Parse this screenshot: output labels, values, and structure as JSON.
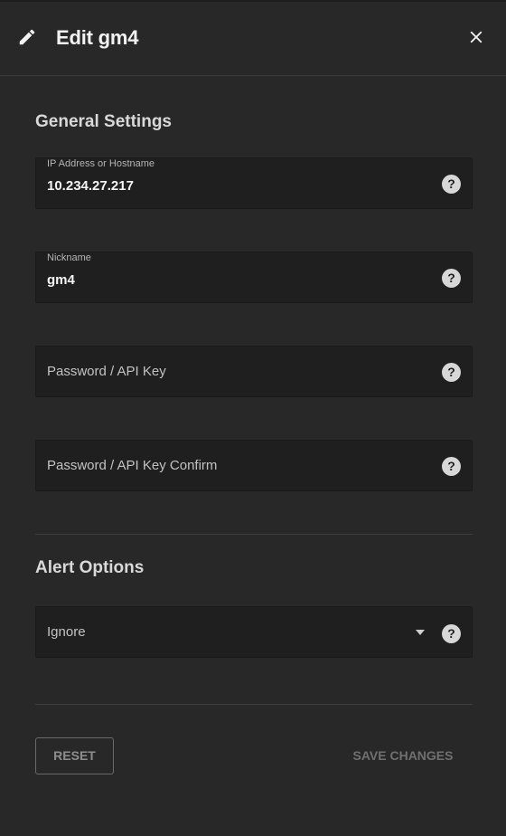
{
  "header": {
    "title": "Edit gm4",
    "edit_icon": "pencil-icon",
    "close_icon": "close-icon"
  },
  "general": {
    "heading": "General Settings",
    "ip_field": {
      "label": "IP Address or Hostname",
      "value": "10.234.27.217"
    },
    "nickname_field": {
      "label": "Nickname",
      "value": "gm4"
    },
    "password_field": {
      "placeholder": "Password / API Key"
    },
    "password_confirm_field": {
      "placeholder": "Password / API Key Confirm"
    }
  },
  "alerts": {
    "heading": "Alert Options",
    "select": {
      "selected": "Ignore"
    }
  },
  "help_glyph": "?",
  "actions": {
    "reset_label": "RESET",
    "save_label": "SAVE CHANGES"
  },
  "colors": {
    "background": "#282828",
    "field_background": "#1f1f1f",
    "text_primary": "#f5f5f5",
    "help_icon": "#d7d7d7"
  }
}
